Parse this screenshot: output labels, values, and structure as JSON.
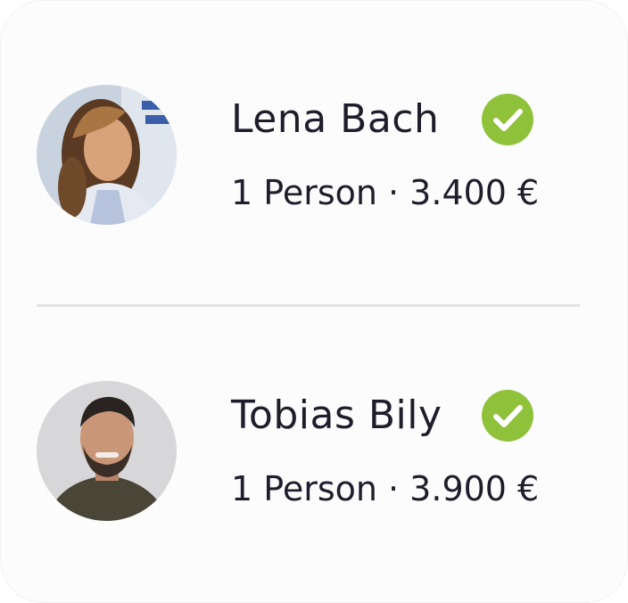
{
  "people": [
    {
      "name": "Lena Bach",
      "details": "1 Person · 3.400 €",
      "verified": true,
      "avatar_icon": "profile-photo-woman"
    },
    {
      "name": "Tobias Bily",
      "details": "1 Person · 3.900 €",
      "verified": true,
      "avatar_icon": "profile-photo-man"
    }
  ],
  "colors": {
    "check_badge": "#8fc13a",
    "text": "#1f1d2b",
    "divider": "#e3e3e6",
    "card": "#fcfcfd"
  }
}
